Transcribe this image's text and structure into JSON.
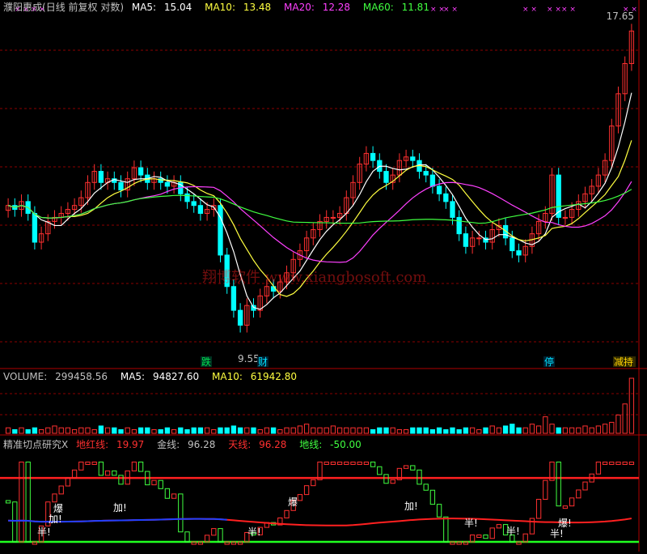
{
  "price_panel": {
    "stock_name": "濮阳惠成",
    "mode": "(日线 前复权 对数)",
    "ma5_label": "MA5:",
    "ma5_value": "15.04",
    "ma10_label": "MA10:",
    "ma10_value": "13.48",
    "ma20_label": "MA20:",
    "ma20_value": "12.28",
    "ma60_label": "MA60:",
    "ma60_value": "11.81",
    "high_label": "17.65",
    "low_label": "9.55",
    "watermark": "翔博软件 www.xiangbosoft.com",
    "signals": [
      {
        "text": "跌",
        "color": "#00e050"
      },
      {
        "text": "财",
        "color": "#00e0ff"
      },
      {
        "text": "停",
        "color": "#00e0ff"
      },
      {
        "text": "减持",
        "color": "#ffd200"
      }
    ]
  },
  "volume_panel": {
    "label": "VOLUME:",
    "value": "299458.56",
    "ma5_label": "MA5:",
    "ma5_value": "94827.60",
    "ma10_label": "MA10:",
    "ma10_value": "61942.80"
  },
  "indicator_panel": {
    "name": "精准切点研究X",
    "red_line_label": "地红线:",
    "red_line_value": "19.97",
    "gold_line_label": "金线:",
    "gold_line_value": "96.28",
    "sky_line_label": "天线:",
    "sky_line_value": "96.28",
    "ground_line_label": "地线:",
    "ground_line_value": "-50.00",
    "annotations": [
      "加!",
      "爆",
      "半!",
      "加!",
      "爆",
      "半!",
      "加!",
      "半!",
      "半!",
      "爆!",
      "半!"
    ]
  },
  "colors": {
    "up": "#ff3030",
    "down": "#00ffff",
    "ma5": "#ffffff",
    "ma10": "#ffff40",
    "ma20": "#ff40ff",
    "ma60": "#40ff40",
    "grid": "#8b0000",
    "text_gray": "#c0c0c0"
  },
  "chart_data": {
    "type": "candlestick",
    "y_scale": "log",
    "price_range_shown": [
      9.55,
      17.65
    ],
    "close_series": [
      12.3,
      12.2,
      12.4,
      12.1,
      11.4,
      11.6,
      11.9,
      12.0,
      12.1,
      12.2,
      12.3,
      12.5,
      12.9,
      13.2,
      12.9,
      13.0,
      12.9,
      12.7,
      13.0,
      13.3,
      13.1,
      12.9,
      13.0,
      12.9,
      12.8,
      12.9,
      12.6,
      12.4,
      12.3,
      12.1,
      12.2,
      12.3,
      11.1,
      10.4,
      9.9,
      9.6,
      10.0,
      9.9,
      10.2,
      10.4,
      10.3,
      10.5,
      10.7,
      11.0,
      11.2,
      11.5,
      11.7,
      11.9,
      12.0,
      12.0,
      12.1,
      12.5,
      12.9,
      13.4,
      13.7,
      13.5,
      13.2,
      12.9,
      13.1,
      13.5,
      13.6,
      13.5,
      13.2,
      13.1,
      12.8,
      12.6,
      12.4,
      12.0,
      11.6,
      11.3,
      11.5,
      11.5,
      11.4,
      11.7,
      11.8,
      11.5,
      11.2,
      11.1,
      11.3,
      11.6,
      11.9,
      12.1,
      13.1,
      12.0,
      12.0,
      12.2,
      12.4,
      12.6,
      12.8,
      13.1,
      13.5,
      14.5,
      15.5,
      16.5,
      17.65
    ],
    "volume_series": [
      3,
      2,
      3,
      2,
      3,
      2,
      3,
      4,
      3,
      3,
      2,
      3,
      3,
      2,
      4,
      3,
      3,
      2,
      3,
      2,
      3,
      3,
      2,
      2,
      3,
      2,
      3,
      2,
      3,
      3,
      3,
      2,
      3,
      3,
      4,
      3,
      3,
      3,
      2,
      3,
      3,
      2,
      3,
      3,
      4,
      5,
      3,
      3,
      3,
      4,
      3,
      3,
      3,
      3,
      3,
      2,
      3,
      3,
      3,
      2,
      2,
      3,
      3,
      3,
      2,
      3,
      2,
      3,
      2,
      3,
      3,
      2,
      3,
      4,
      3,
      4,
      5,
      3,
      3,
      5,
      4,
      9,
      5,
      3,
      3,
      3,
      3,
      4,
      3,
      4,
      5,
      6,
      10,
      16,
      30
    ],
    "indicator_series": {
      "sky_line": 74,
      "ground_line": 6,
      "current_red_line": 19.97,
      "current_gold_line": 96.28
    }
  }
}
